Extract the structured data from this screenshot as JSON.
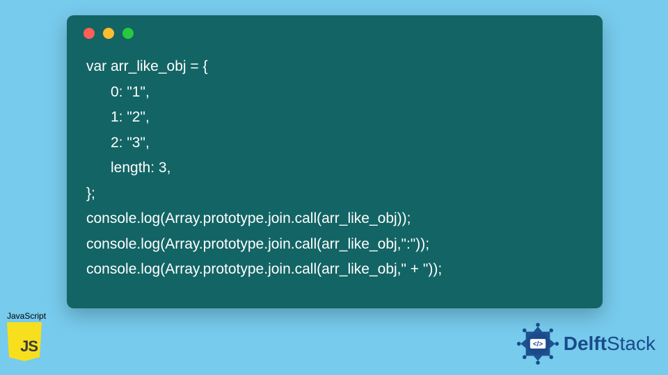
{
  "window": {
    "dots": [
      "red",
      "yellow",
      "green"
    ]
  },
  "code": {
    "lines": [
      "var arr_like_obj = {",
      "      0: \"1\",",
      "      1: \"2\",",
      "      2: \"3\",",
      "      length: 3,",
      "};",
      "console.log(Array.prototype.join.call(arr_like_obj));",
      "console.log(Array.prototype.join.call(arr_like_obj,\":\"));",
      "console.log(Array.prototype.join.call(arr_like_obj,\" + \"));"
    ]
  },
  "badge": {
    "language_label": "JavaScript",
    "logo_text": "JS"
  },
  "brand": {
    "name_bold": "Delft",
    "name_light": "Stack"
  },
  "colors": {
    "background": "#77cbed",
    "window_bg": "#136465",
    "code_text": "#ffffff",
    "js_yellow": "#f7df1e",
    "brand_blue": "#1a4a8a"
  }
}
